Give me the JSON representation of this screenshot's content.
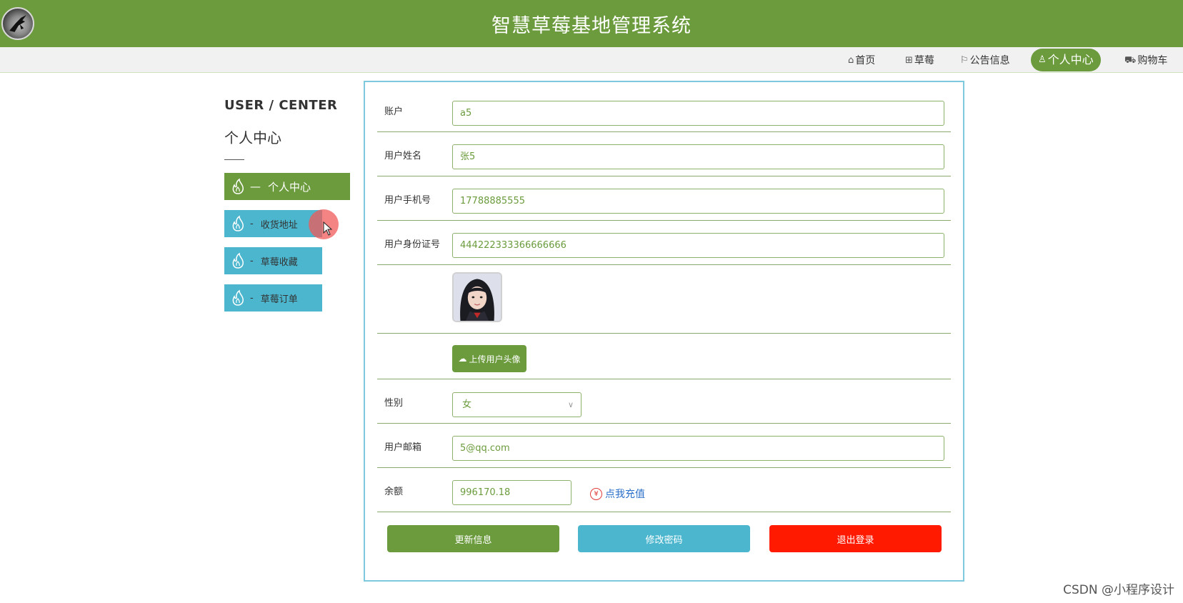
{
  "header": {
    "title": "智慧草莓基地管理系统",
    "logo_icon": "logo-badge"
  },
  "nav": {
    "items": [
      {
        "label": "首页",
        "icon": "home-icon"
      },
      {
        "label": "草莓",
        "icon": "shop-icon"
      },
      {
        "label": "公告信息",
        "icon": "flag-icon"
      },
      {
        "label": "个人中心",
        "icon": "user-icon",
        "active": true
      },
      {
        "label": "购物车",
        "icon": "cart-icon"
      }
    ]
  },
  "sidebar": {
    "title_en": "USER / CENTER",
    "title_cn": "个人中心",
    "items": [
      {
        "label": "个人中心",
        "active": true
      },
      {
        "label": "收货地址"
      },
      {
        "label": "草莓收藏"
      },
      {
        "label": "草莓订单"
      }
    ]
  },
  "form": {
    "account": {
      "label": "账户",
      "value": "a5"
    },
    "name": {
      "label": "用户姓名",
      "value": "张5"
    },
    "phone": {
      "label": "用户手机号",
      "value": "17788885555"
    },
    "idcard": {
      "label": "用户身份证号",
      "value": "444222333366666666"
    },
    "upload_label": "上传用户头像",
    "gender": {
      "label": "性别",
      "value": "女"
    },
    "email": {
      "label": "用户邮箱",
      "value": "5@qq.com"
    },
    "balance": {
      "label": "余额",
      "value": "996170.18",
      "recharge_label": "点我充值"
    }
  },
  "actions": {
    "update": "更新信息",
    "password": "修改密码",
    "logout": "退出登录"
  },
  "colors": {
    "primary": "#6b9b3c",
    "info": "#4bb6ce",
    "danger": "#ff1a00"
  },
  "watermark": "CSDN @小程序设计"
}
